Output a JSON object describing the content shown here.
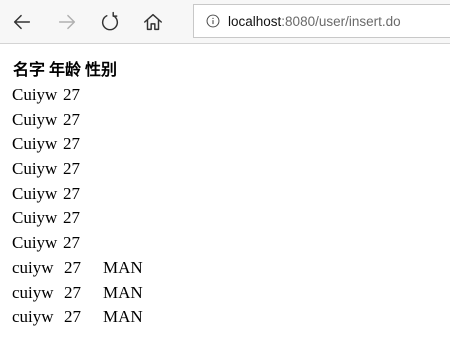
{
  "browser": {
    "url_host": "localhost",
    "url_rest": ":8080/user/insert.do",
    "icons": [
      "back-arrow-icon",
      "forward-arrow-icon",
      "refresh-icon",
      "home-icon",
      "info-icon"
    ]
  },
  "table": {
    "headers": [
      "名字",
      "年龄",
      "性别"
    ]
  },
  "rows": [
    {
      "name": "Cuiyw",
      "age": "27",
      "gender": ""
    },
    {
      "name": "Cuiyw",
      "age": "27",
      "gender": ""
    },
    {
      "name": "Cuiyw",
      "age": "27",
      "gender": ""
    },
    {
      "name": "Cuiyw",
      "age": "27",
      "gender": ""
    },
    {
      "name": "Cuiyw",
      "age": "27",
      "gender": ""
    },
    {
      "name": "Cuiyw",
      "age": "27",
      "gender": ""
    },
    {
      "name": "Cuiyw",
      "age": "27",
      "gender": ""
    },
    {
      "name": "cuiyw",
      "age": "27",
      "gender": "MAN"
    },
    {
      "name": "cuiyw",
      "age": "27",
      "gender": "MAN"
    },
    {
      "name": "cuiyw",
      "age": "27",
      "gender": "MAN"
    }
  ]
}
